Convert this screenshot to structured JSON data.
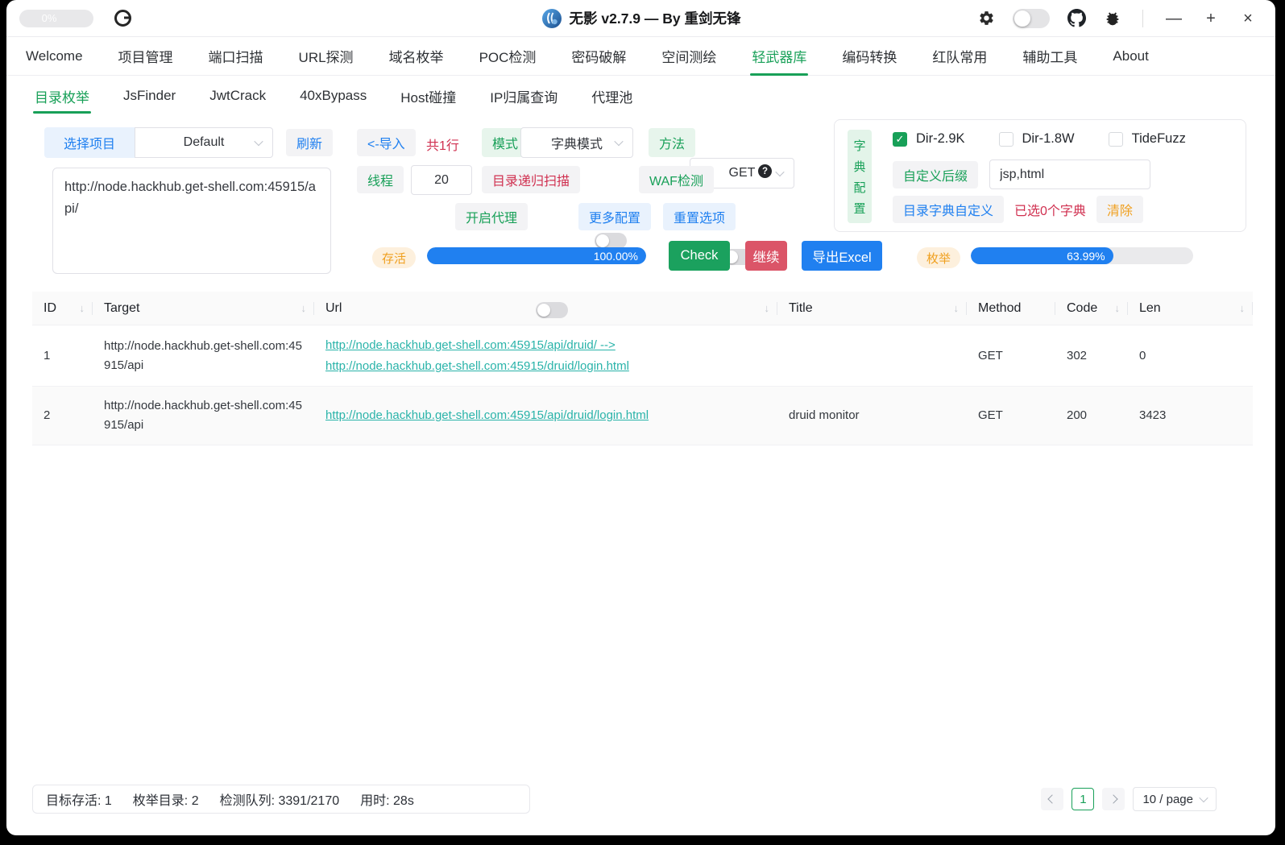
{
  "window": {
    "progress_pill": "0%",
    "title": "无影 v2.7.9 — By 重剑无锋",
    "minimize": "—",
    "maximize": "+",
    "close": "×"
  },
  "nav": {
    "items": [
      {
        "label": "Welcome",
        "active": false
      },
      {
        "label": "项目管理",
        "active": false
      },
      {
        "label": "端口扫描",
        "active": false
      },
      {
        "label": "URL探测",
        "active": false
      },
      {
        "label": "域名枚举",
        "active": false
      },
      {
        "label": "POC检测",
        "active": false
      },
      {
        "label": "密码破解",
        "active": false
      },
      {
        "label": "空间测绘",
        "active": false
      },
      {
        "label": "轻武器库",
        "active": true
      },
      {
        "label": "编码转换",
        "active": false
      },
      {
        "label": "红队常用",
        "active": false
      },
      {
        "label": "辅助工具",
        "active": false
      },
      {
        "label": "About",
        "active": false
      }
    ]
  },
  "subnav": {
    "items": [
      {
        "label": "目录枚举",
        "active": true
      },
      {
        "label": "JsFinder",
        "active": false
      },
      {
        "label": "JwtCrack",
        "active": false
      },
      {
        "label": "40xBypass",
        "active": false
      },
      {
        "label": "Host碰撞",
        "active": false
      },
      {
        "label": "IP归属查询",
        "active": false
      },
      {
        "label": "代理池",
        "active": false
      }
    ]
  },
  "config": {
    "project_label": "选择项目",
    "project_value": "Default",
    "refresh_label": "刷新",
    "target_value": "http://node.hackhub.get-shell.com:45915/api/",
    "import_label": "<-导入",
    "line_count": "共1行",
    "mode_label": "模式",
    "mode_value": "字典模式",
    "method_label": "方法",
    "method_value": "GET",
    "threads_label": "线程",
    "threads_value": "20",
    "recursive_label": "目录递归扫描",
    "waf_label": "WAF检测",
    "help_label": "?",
    "proxy_label": "开启代理",
    "more_label": "更多配置",
    "reset_label": "重置选项",
    "alive_label": "存活",
    "alive_progress_text": "100.00%",
    "alive_progress_percent": 100,
    "check_label": "Check",
    "continue_label": "继续",
    "export_label": "导出Excel",
    "enum_label": "枚举",
    "enum_progress_text": "63.99%",
    "enum_progress_percent": 64
  },
  "dict_panel": {
    "vertical_label": "字典配置",
    "checkboxes": [
      {
        "label": "Dir-2.9K",
        "checked": true
      },
      {
        "label": "Dir-1.8W",
        "checked": false
      },
      {
        "label": "TideFuzz",
        "checked": false
      }
    ],
    "suffix_label": "自定义后缀",
    "suffix_value": "jsp,html",
    "custom_dict_label": "目录字典自定义",
    "selected_count": "已选0个字典",
    "clear_label": "清除"
  },
  "table": {
    "columns": [
      {
        "key": "id",
        "label": "ID",
        "sortable": true
      },
      {
        "key": "target",
        "label": "Target",
        "sortable": true
      },
      {
        "key": "url",
        "label": "Url",
        "sortable": true
      },
      {
        "key": "title",
        "label": "Title",
        "sortable": true
      },
      {
        "key": "method",
        "label": "Method",
        "sortable": false
      },
      {
        "key": "code",
        "label": "Code",
        "sortable": true
      },
      {
        "key": "len",
        "label": "Len",
        "sortable": true
      }
    ],
    "rows": [
      {
        "id": "1",
        "target": "http://node.hackhub.get-shell.com:45915/api",
        "urls": [
          "http://node.hackhub.get-shell.com:45915/api/druid/ -->",
          "http://node.hackhub.get-shell.com:45915/druid/login.html"
        ],
        "title": "",
        "method": "GET",
        "code": "302",
        "len": "0"
      },
      {
        "id": "2",
        "target": "http://node.hackhub.get-shell.com:45915/api",
        "urls": [
          "http://node.hackhub.get-shell.com:45915/api/druid/login.html"
        ],
        "title": "druid monitor",
        "method": "GET",
        "code": "200",
        "len": "3423"
      }
    ]
  },
  "statusbar": {
    "segments": [
      "目标存活: 1",
      "枚举目录: 2",
      "检测队列: 3391/2170",
      "用时: 28s"
    ]
  },
  "pagination": {
    "current_page": "1",
    "page_size": "10 / page"
  },
  "colors": {
    "accent_green": "#18a058",
    "info_blue": "#2080f0",
    "error_red": "#d03050",
    "warning_orange": "#f0a020",
    "link_teal": "#29b3a9",
    "button_red": "#db5568"
  }
}
